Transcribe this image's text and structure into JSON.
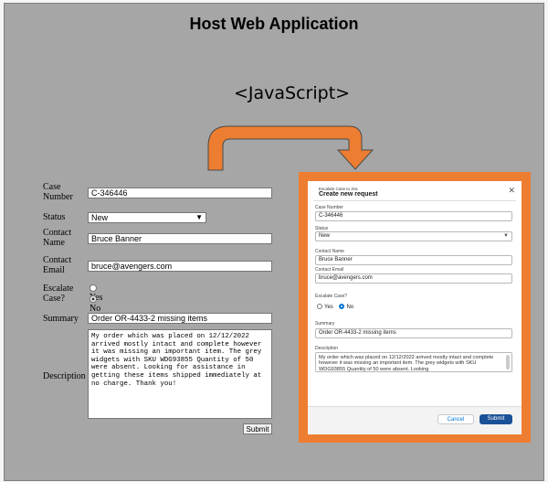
{
  "title": "Host Web Application",
  "connector_label": "<JavaScript>",
  "legacy_form": {
    "case_number": {
      "label": "Case Number",
      "value": "C-346446"
    },
    "status": {
      "label": "Status",
      "value": "New"
    },
    "contact_name": {
      "label": "Contact Name",
      "value": "Bruce Banner"
    },
    "contact_email": {
      "label": "Contact Email",
      "value": "bruce@avengers.com"
    },
    "escalate": {
      "label": "Escalate Case?",
      "yes": "Yes",
      "no": "No",
      "selected": "No"
    },
    "summary": {
      "label": "Summary",
      "value": "Order OR-4433-2 missing items"
    },
    "description": {
      "label": "Description",
      "value": "My order which was placed on 12/12/2022 arrived mostly intact and complete however it was missing an important item. The grey widgets with SKU WDG93855 Quantity of 50 were absent. Looking for assistance in getting these items shipped immediately at no charge. Thank you!"
    },
    "submit": "Submit"
  },
  "modal": {
    "eyebrow": "Escalate Case to Jira",
    "heading": "Create new request",
    "close_icon": "close-icon",
    "case_number": {
      "label": "Case Number",
      "value": "C-346446"
    },
    "status": {
      "label": "Status",
      "value": "New"
    },
    "contact_name": {
      "label": "Contact Name",
      "value": "Bruce Banner"
    },
    "contact_email": {
      "label": "Contact Email",
      "value": "bruce@avengers.com"
    },
    "escalate": {
      "label": "Escalate Case?",
      "yes": "Yes",
      "no": "No",
      "selected": "No"
    },
    "summary": {
      "label": "Summary",
      "value": "Order OR-4433-2 missing items"
    },
    "description": {
      "label": "Description",
      "value": "My order which was placed on 12/12/2022 arrived mostly intact and complete however it was missing an important item. The grey widgets with SKU WDG93855 Quantity of 50 were absent. Looking"
    },
    "cancel": "Cancel",
    "submit": "Submit"
  },
  "colors": {
    "background": "#a6a6a6",
    "arrow": "#ed7d31",
    "frame": "#ed7d31",
    "primary_button": "#1b5297"
  }
}
